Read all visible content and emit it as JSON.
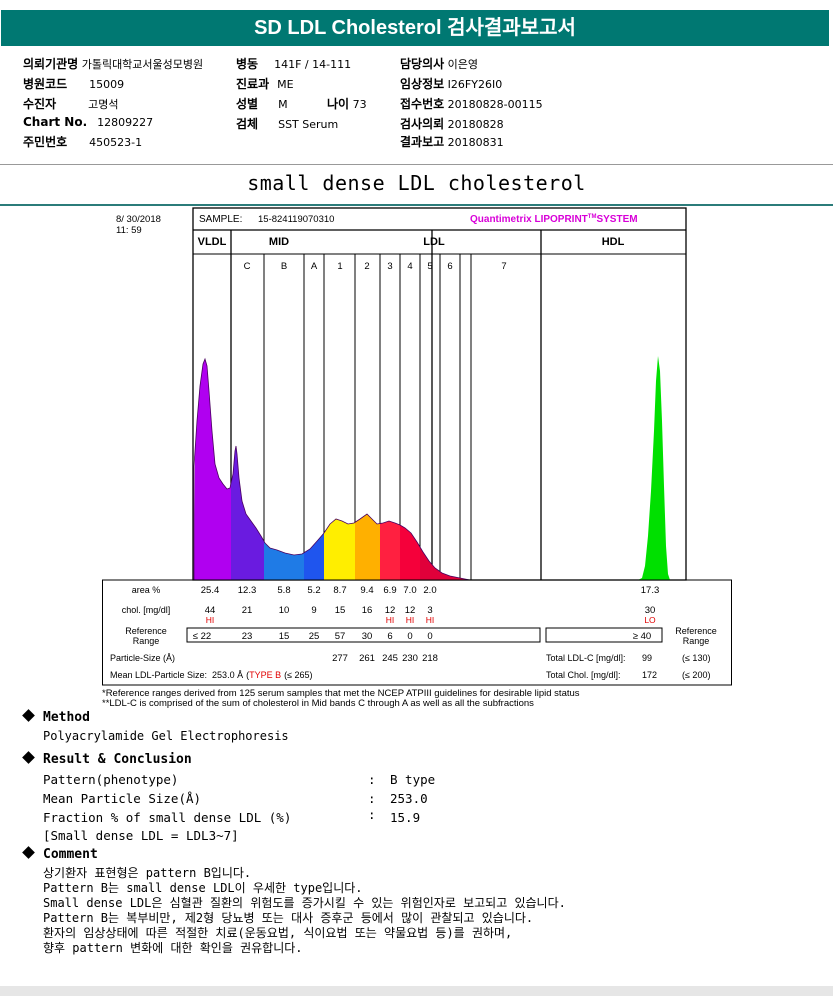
{
  "header": {
    "title": "SD LDL Cholesterol 검사결과보고서"
  },
  "patient": {
    "col1": [
      {
        "label": "의뢰기관명",
        "value": "가톨릭대학교서울성모병원"
      },
      {
        "label": "병원코드",
        "value": "15009"
      },
      {
        "label": "수진자",
        "value": "고명석"
      },
      {
        "label": "Chart No.",
        "value": "12809227"
      },
      {
        "label": "주민번호",
        "value": "450523-1"
      }
    ],
    "col2": [
      {
        "label": "병동",
        "value": "141F / 14-111"
      },
      {
        "label": "진료과",
        "value": "ME"
      },
      {
        "label": "성별",
        "value": "M"
      },
      {
        "label": "검체",
        "value": "SST Serum"
      }
    ],
    "age": {
      "label": "나이",
      "value": "73"
    },
    "col3": [
      {
        "label": "담당의사",
        "value": "이은영"
      },
      {
        "label": "임상정보",
        "value": "I26FY26I0"
      },
      {
        "label": "접수번호",
        "value": "20180828-00115"
      },
      {
        "label": "검사의뢰",
        "value": "20180828"
      },
      {
        "label": "결과보고",
        "value": "20180831"
      }
    ]
  },
  "lipoprint": {
    "title": "small dense LDL cholesterol"
  },
  "chart_data": {
    "type": "area",
    "date": "8/ 30/2018",
    "time": "11: 59",
    "sample_label": "SAMPLE:",
    "sample_id": "15-824119070310",
    "brand": "Quantimetrix LIPOPRINT",
    "brand_tm": "TM",
    "brand_system": "SYSTEM",
    "groups": [
      "VLDL",
      "MID",
      "LDL",
      "HDL"
    ],
    "bands": [
      "C",
      "B",
      "A",
      "1",
      "2",
      "3",
      "4",
      "5",
      "6",
      "7"
    ],
    "area_label": "area %",
    "area_values": [
      "25.4",
      "12.3",
      "5.8",
      "5.2",
      "8.7",
      "9.4",
      "6.9",
      "7.0",
      "2.0",
      "17.3"
    ],
    "chol_label": "chol. [mg/dl]",
    "chol_values": [
      "44",
      "21",
      "10",
      "9",
      "15",
      "16",
      "12",
      "12",
      "3",
      "30"
    ],
    "chol_flags": [
      "HI",
      "",
      "",
      "",
      "",
      "",
      "HI",
      "HI",
      "HI",
      "LO"
    ],
    "ref_label_1": "Reference",
    "ref_label_2": "Range",
    "ref_values": [
      "≤ 22",
      "23",
      "15",
      "25",
      "57",
      "30",
      "6",
      "0",
      "0",
      "≥ 40"
    ],
    "particle_size_label": "Particle-Size (Å)",
    "particle_sizes": [
      "277",
      "261",
      "245",
      "230",
      "218"
    ],
    "mean_size_label": "Mean LDL-Particle Size:",
    "mean_size_value": "253.0 Å",
    "mean_size_type": "TYPE B",
    "mean_size_ref": "(≤ 265)",
    "total_ldl_label": "Total LDL-C [mg/dl]:",
    "total_ldl_value": "99",
    "total_ldl_ref": "(≤ 130)",
    "total_chol_label": "Total Chol. [mg/dl]:",
    "total_chol_value": "172",
    "total_chol_ref": "(≤ 200)",
    "colors": {
      "vldl": "#b000f0",
      "mid_c": "#6a1be0",
      "mid_b": "#1f7be6",
      "mid_a": "#1f55ee",
      "ldl1": "#ffee00",
      "ldl2": "#ffb000",
      "ldl3": "#ff2040",
      "ldl4": "#f5003a",
      "ldl5": "#e0003a",
      "hdl": "#00e000",
      "brand": "#d800d8",
      "flag": "#e00000"
    }
  },
  "notes": {
    "line1": "*Reference ranges derived from 125 serum samples that met the NCEP ATPIII guidelines for desirable lipid status",
    "line2": "**LDL-C is comprised of the sum of cholesterol in Mid bands C through A as well as all the subfractions"
  },
  "method": {
    "heading": "Method",
    "text": "Polyacrylamide Gel Electrophoresis"
  },
  "result": {
    "heading": "Result & Conclusion",
    "rows": [
      {
        "label": "Pattern(phenotype)",
        "colon": ":",
        "value": "B type"
      },
      {
        "label": "Mean Particle Size(Å)",
        "colon": ":",
        "value": "253.0"
      },
      {
        "label": "Fraction % of small dense LDL (%)",
        "colon": ":",
        "value": "15.9"
      }
    ],
    "note": "[Small dense LDL = LDL3~7]"
  },
  "comment": {
    "heading": "Comment",
    "lines": [
      "상기환자 표현형은 pattern B입니다.",
      "Pattern B는 small dense LDL이 우세한 type입니다.",
      "Small dense LDL은 심혈관 질환의 위험도를 증가시킬 수 있는 위험인자로 보고되고 있습니다.",
      "Pattern B는 복부비만, 제2형 당뇨병 또는 대사 증후군 등에서 많이 관찰되고 있습니다.",
      "환자의 임상상태에 따른 적절한 치료(운동요법, 식이요법 또는 약물요법 등)를 권하며,",
      "향후 pattern 변화에 대한 확인을 권유합니다."
    ]
  }
}
